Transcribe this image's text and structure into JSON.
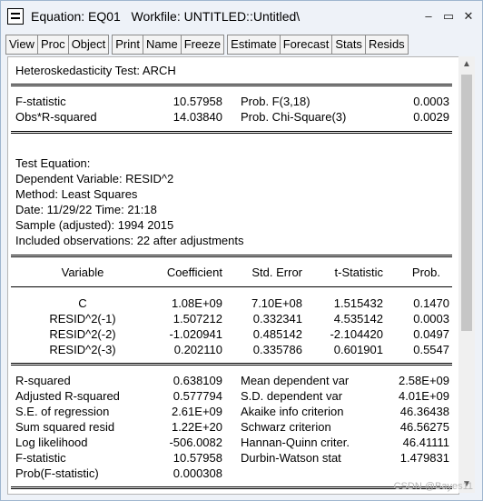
{
  "window": {
    "title": "Equation: EQ01   Workfile: UNTITLED::Untitled\\",
    "minimize": "–",
    "maximize": "▭",
    "close": "✕"
  },
  "toolbar": [
    "View",
    "Proc",
    "Object",
    "Print",
    "Name",
    "Freeze",
    "Estimate",
    "Forecast",
    "Stats",
    "Resids"
  ],
  "test": {
    "title": "Heteroskedasticity Test: ARCH",
    "rows": [
      {
        "label": "F-statistic",
        "value": "10.57958",
        "prob_label": "Prob. F(3,18)",
        "prob": "0.0003"
      },
      {
        "label": "Obs*R-squared",
        "value": "14.03840",
        "prob_label": "Prob. Chi-Square(3)",
        "prob": "0.0029"
      }
    ]
  },
  "equation": {
    "lines": [
      "Test Equation:",
      "Dependent Variable: RESID^2",
      "Method: Least Squares",
      "Date: 11/29/22   Time: 21:18",
      "Sample (adjusted): 1994 2015",
      "Included observations: 22 after adjustments"
    ]
  },
  "coef": {
    "headers": [
      "Variable",
      "Coefficient",
      "Std. Error",
      "t-Statistic",
      "Prob."
    ],
    "rows": [
      [
        "C",
        "1.08E+09",
        "7.10E+08",
        "1.515432",
        "0.1470"
      ],
      [
        "RESID^2(-1)",
        "1.507212",
        "0.332341",
        "4.535142",
        "0.0003"
      ],
      [
        "RESID^2(-2)",
        "-1.020941",
        "0.485142",
        "-2.104420",
        "0.0497"
      ],
      [
        "RESID^2(-3)",
        "0.202110",
        "0.335786",
        "0.601901",
        "0.5547"
      ]
    ]
  },
  "stats": {
    "left": [
      [
        "R-squared",
        "0.638109"
      ],
      [
        "Adjusted R-squared",
        "0.577794"
      ],
      [
        "S.E. of regression",
        "2.61E+09"
      ],
      [
        "Sum squared resid",
        "1.22E+20"
      ],
      [
        "Log likelihood",
        "-506.0082"
      ],
      [
        "F-statistic",
        "10.57958"
      ],
      [
        "Prob(F-statistic)",
        "0.000308"
      ]
    ],
    "right": [
      [
        "Mean dependent var",
        "2.58E+09"
      ],
      [
        "S.D. dependent var",
        "4.01E+09"
      ],
      [
        "Akaike info criterion",
        "46.36438"
      ],
      [
        "Schwarz criterion",
        "46.56275"
      ],
      [
        "Hannan-Quinn criter.",
        "46.41111"
      ],
      [
        "Durbin-Watson stat",
        "1.479831"
      ]
    ]
  },
  "watermark": "CSDN @Bayes11",
  "colors": {
    "window_bg": "#eef2f8",
    "content_bg": "#ffffff",
    "border": "#9fb6cf"
  }
}
